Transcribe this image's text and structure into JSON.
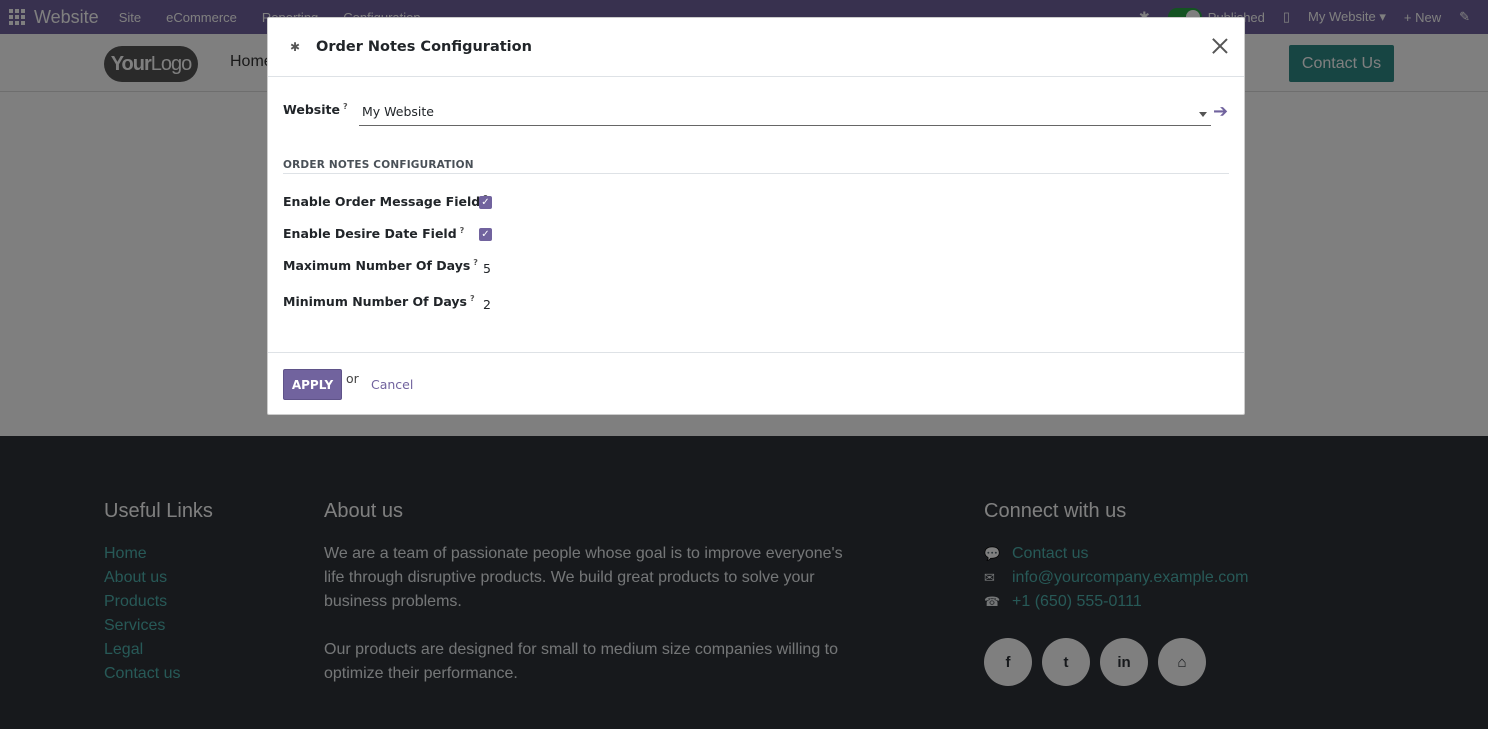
{
  "topbar": {
    "brand": "Website",
    "menus": [
      "Site",
      "eCommerce",
      "Reporting",
      "Configuration"
    ],
    "published_label": "Published",
    "website_selector": "My Website",
    "new_label": "New"
  },
  "site": {
    "logo_your": "Your",
    "logo_logo": "Logo",
    "nav_home": "Home",
    "contact_button": "Contact Us"
  },
  "footer": {
    "useful_links_title": "Useful Links",
    "useful_links": [
      "Home",
      "About us",
      "Products",
      "Services",
      "Legal",
      "Contact us"
    ],
    "about_title": "About us",
    "about_p1": "We are a team of passionate people whose goal is to improve everyone's life through disruptive products. We build great products to solve your business problems.",
    "about_p2": "Our products are designed for small to medium size companies willing to optimize their performance.",
    "connect_title": "Connect with us",
    "connect_contact": "Contact us",
    "connect_email": "info@yourcompany.example.com",
    "connect_phone": "+1 (650) 555-0111"
  },
  "modal": {
    "title": "Order Notes Configuration",
    "website_label": "Website",
    "website_value": "My Website",
    "section_title": "ORDER NOTES CONFIGURATION",
    "enable_message_label": "Enable Order Message Field",
    "enable_message_checked": true,
    "enable_date_label": "Enable Desire Date Field",
    "enable_date_checked": true,
    "max_days_label": "Maximum Number Of Days",
    "max_days_value": "5",
    "min_days_label": "Minimum Number Of Days",
    "min_days_value": "2",
    "apply_label": "APPLY",
    "or_label": "or",
    "cancel_label": "Cancel",
    "help_mark": "?"
  },
  "colors": {
    "primary": "#71639e",
    "footer_bg": "#2e3338",
    "footer_link": "#4fb3af",
    "contact_btn": "#2f8a87"
  }
}
